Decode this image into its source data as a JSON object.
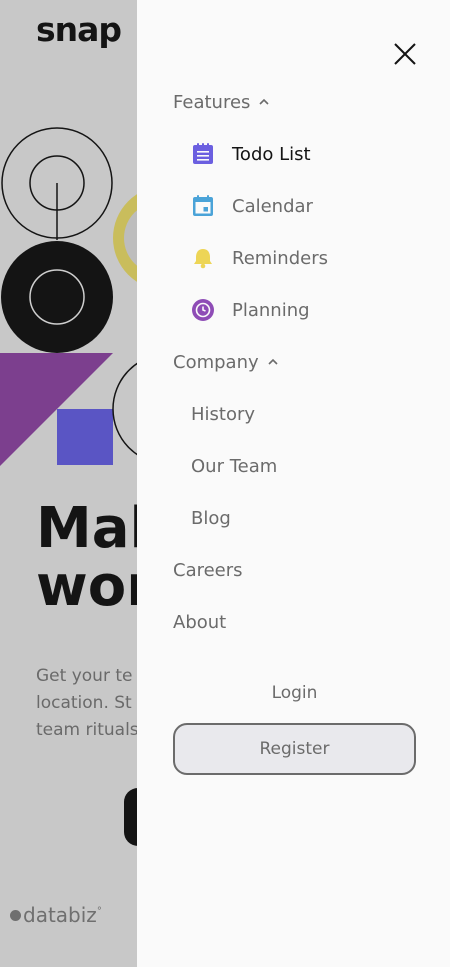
{
  "background": {
    "logo": "snap",
    "hero_title": "Mak\nwor",
    "hero_description": "Get your te\nlocation. St\nteam rituals",
    "client_logo": "databiz"
  },
  "drawer": {
    "close_icon": "close-icon",
    "features": {
      "label": "Features",
      "expanded": true,
      "items": [
        {
          "label": "Todo List",
          "icon": "todo-list-icon",
          "color": "#6b5fe0"
        },
        {
          "label": "Calendar",
          "icon": "calendar-icon",
          "color": "#4aa3d8"
        },
        {
          "label": "Reminders",
          "icon": "bell-icon",
          "color": "#edd556"
        },
        {
          "label": "Planning",
          "icon": "clock-icon",
          "color": "#8e4cb6"
        }
      ]
    },
    "company": {
      "label": "Company",
      "expanded": true,
      "items": [
        {
          "label": "History"
        },
        {
          "label": "Our Team"
        },
        {
          "label": "Blog"
        }
      ]
    },
    "careers": "Careers",
    "about": "About",
    "login": "Login",
    "register": "Register"
  },
  "colors": {
    "overlay": "#c8c8c8",
    "drawer_bg": "#fafafa",
    "text": "#6b6b6b",
    "text_active": "#141414",
    "register_bg": "#e9e9ed"
  }
}
